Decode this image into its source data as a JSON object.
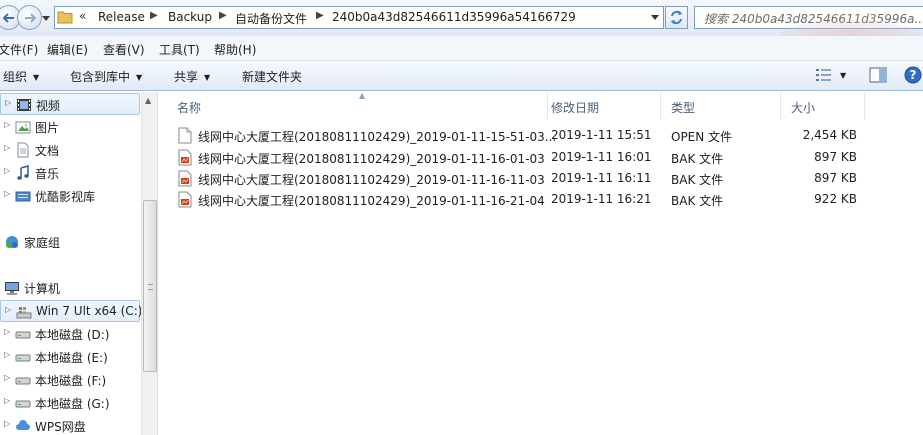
{
  "address": {
    "overflow_chevron": "«",
    "breadcrumbs": [
      "Release",
      "Backup",
      "自动备份文件",
      "240b0a43d82546611d35996a54166729"
    ]
  },
  "search": {
    "placeholder": "搜索 240b0a43d82546611d35996a..."
  },
  "menu": [
    "文件(F)",
    "编辑(E)",
    "查看(V)",
    "工具(T)",
    "帮助(H)"
  ],
  "toolbar": {
    "organize": "组织",
    "include": "包含到库中",
    "share": "共享",
    "new_folder": "新建文件夹"
  },
  "sidebar": {
    "libraries": [
      "视频",
      "图片",
      "文档",
      "音乐",
      "优酷影视库"
    ],
    "homegroup": "家庭组",
    "computer": "计算机",
    "drives": [
      "Win 7 Ult x64 (C:)",
      "本地磁盘 (D:)",
      "本地磁盘 (E:)",
      "本地磁盘 (F:)",
      "本地磁盘 (G:)",
      "WPS网盘"
    ]
  },
  "columns": {
    "name": "名称",
    "modified": "修改日期",
    "type": "类型",
    "size": "大小"
  },
  "files": [
    {
      "name": "线网中心大厦工程(20180811102429)_2019-01-11-15-51-03...",
      "modified": "2019-1-11 15:51",
      "type": "OPEN 文件",
      "size": "2,454 KB",
      "icon": "blank-file-icon"
    },
    {
      "name": "线网中心大厦工程(20180811102429)_2019-01-11-16-01-03",
      "modified": "2019-1-11 16:01",
      "type": "BAK 文件",
      "size": "897 KB",
      "icon": "bak-file-icon"
    },
    {
      "name": "线网中心大厦工程(20180811102429)_2019-01-11-16-11-03",
      "modified": "2019-1-11 16:11",
      "type": "BAK 文件",
      "size": "897 KB",
      "icon": "bak-file-icon"
    },
    {
      "name": "线网中心大厦工程(20180811102429)_2019-01-11-16-21-04",
      "modified": "2019-1-11 16:21",
      "type": "BAK 文件",
      "size": "922 KB",
      "icon": "bak-file-icon"
    }
  ]
}
